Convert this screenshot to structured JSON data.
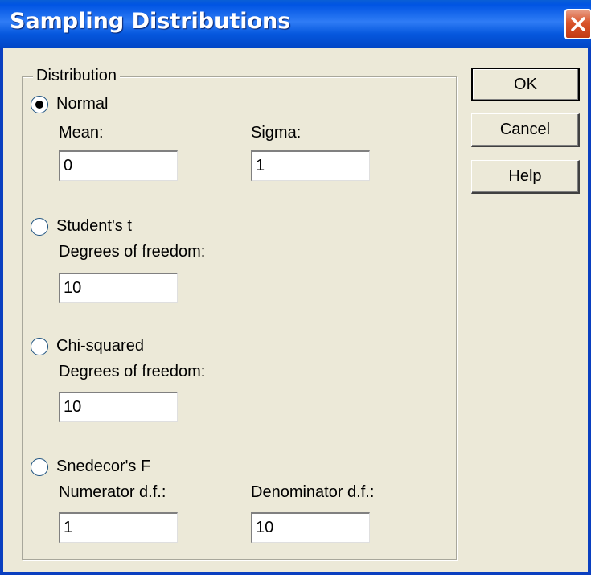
{
  "window": {
    "title": "Sampling Distributions"
  },
  "group": {
    "label": "Distribution"
  },
  "distributions": {
    "normal": {
      "label": "Normal",
      "selected": true,
      "param1_label": "Mean:",
      "param1_value": "0",
      "param2_label": "Sigma:",
      "param2_value": "1"
    },
    "students_t": {
      "label": "Student's t",
      "selected": false,
      "param1_label": "Degrees of freedom:",
      "param1_value": "10"
    },
    "chi_squared": {
      "label": "Chi-squared",
      "selected": false,
      "param1_label": "Degrees of freedom:",
      "param1_value": "10"
    },
    "snedecor_f": {
      "label": "Snedecor's F",
      "selected": false,
      "param1_label": "Numerator d.f.:",
      "param1_value": "1",
      "param2_label": "Denominator d.f.:",
      "param2_value": "10"
    }
  },
  "buttons": {
    "ok": "OK",
    "cancel": "Cancel",
    "help": "Help"
  },
  "icons": {
    "close": "close-icon",
    "radio_selected": "radio-selected-icon"
  },
  "colors": {
    "titlebar": "#0054e3",
    "close_button": "#d9542b",
    "dialog_bg": "#ece9d8"
  }
}
